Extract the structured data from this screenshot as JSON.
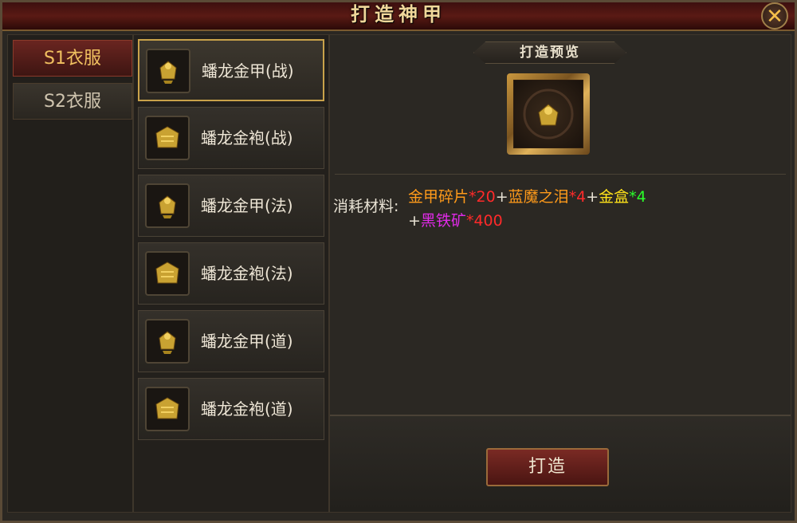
{
  "window": {
    "title": "打造神甲",
    "close_label": "✕"
  },
  "servers": [
    {
      "label": "S1衣服",
      "active": true
    },
    {
      "label": "S2衣服",
      "active": false
    }
  ],
  "items": [
    {
      "name": "蟠龙金甲(战)",
      "icon": "armor-icon",
      "selected": true
    },
    {
      "name": "蟠龙金袍(战)",
      "icon": "robe-icon",
      "selected": false
    },
    {
      "name": "蟠龙金甲(法)",
      "icon": "armor-icon",
      "selected": false
    },
    {
      "name": "蟠龙金袍(法)",
      "icon": "robe-icon",
      "selected": false
    },
    {
      "name": "蟠龙金甲(道)",
      "icon": "armor-icon",
      "selected": false
    },
    {
      "name": "蟠龙金袍(道)",
      "icon": "robe-icon",
      "selected": false
    }
  ],
  "preview": {
    "label": "打造预览",
    "icon": "armor-icon"
  },
  "materials": {
    "label": "消耗材料:",
    "line1": [
      {
        "text": "金甲碎片",
        "color": "#ff9a1a"
      },
      {
        "text": "*20",
        "color": "#ff2a2a"
      },
      {
        "text": "+",
        "color": "#e8e2d4"
      },
      {
        "text": "蓝魔之泪",
        "color": "#ff9a1a"
      },
      {
        "text": "*4",
        "color": "#ff2a2a"
      },
      {
        "text": "+",
        "color": "#e8e2d4"
      },
      {
        "text": "金盒",
        "color": "#ffe21a"
      },
      {
        "text": "*4",
        "color": "#2aff2a"
      }
    ],
    "line2": [
      {
        "text": "+",
        "color": "#e8e2d4"
      },
      {
        "text": "黑铁矿",
        "color": "#e02ae8"
      },
      {
        "text": "*400",
        "color": "#ff2a2a"
      }
    ]
  },
  "actions": {
    "forge_label": "打造"
  },
  "colors": {
    "accent_gold": "#c9a24a",
    "title_bg": "#5a1a14"
  }
}
